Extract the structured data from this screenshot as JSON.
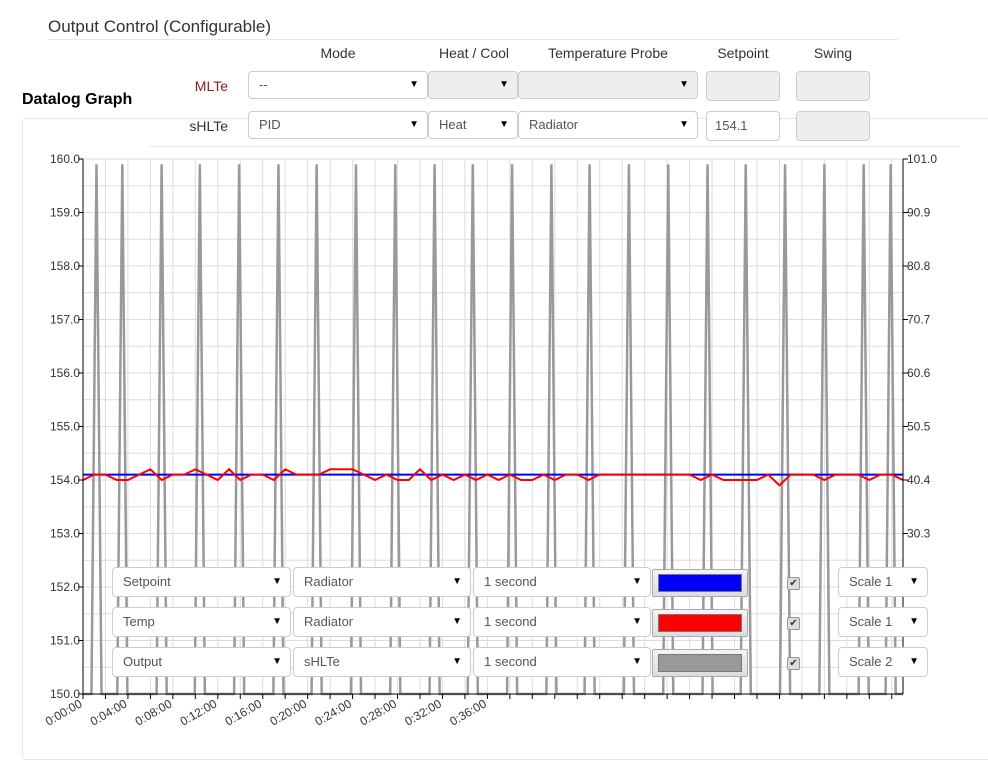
{
  "output_control": {
    "title": "Output Control (Configurable)",
    "headers": [
      "Mode",
      "Heat / Cool",
      "Temperature Probe",
      "Setpoint",
      "Swing"
    ],
    "rows": [
      {
        "label": "MLTe",
        "mode": "--",
        "heat_cool": "",
        "probe": "",
        "setpoint": "",
        "swing": "",
        "disabled": true
      },
      {
        "label": "sHLTe",
        "mode": "PID",
        "heat_cool": "Heat",
        "probe": "Radiator",
        "setpoint": "154.1",
        "swing": "",
        "disabled": false
      }
    ]
  },
  "datalog": {
    "title": "Datalog Graph",
    "series_rows": [
      {
        "type": "Setpoint",
        "source": "Radiator",
        "interval": "1 second",
        "color": "#0000ff",
        "checked": true,
        "scale": "Scale 1"
      },
      {
        "type": "Temp",
        "source": "Radiator",
        "interval": "1 second",
        "color": "#ff0000",
        "checked": true,
        "scale": "Scale 1"
      },
      {
        "type": "Output",
        "source": "sHLTe",
        "interval": "1 second",
        "color": "#999999",
        "checked": true,
        "scale": "Scale 2"
      }
    ]
  },
  "chart_data": {
    "type": "line",
    "grid": true,
    "xlim_minutes": [
      0,
      73
    ],
    "x_tick_labels": [
      "0:00:00",
      "0:04:00",
      "0:08:00",
      "0:12:00",
      "0:16:00",
      "0:20:00",
      "0:24:00",
      "0:28:00",
      "0:32:00",
      "0:36:00"
    ],
    "y_left": {
      "lim": [
        150,
        160
      ],
      "tick_labels": [
        "150.0",
        "151.0",
        "152.0",
        "153.0",
        "154.0",
        "155.0",
        "156.0",
        "157.0",
        "158.0",
        "159.0",
        "160.0"
      ]
    },
    "y_right": {
      "lim": [
        0,
        101
      ],
      "tick_labels": [
        "30.3",
        "40.4",
        "50.5",
        "60.6",
        "70.7",
        "80.8",
        "90.9",
        "101.0"
      ]
    },
    "series": [
      {
        "color": "#0000ff",
        "axis": "left",
        "x": [
          0,
          73
        ],
        "y": [
          154.1,
          154.1
        ]
      },
      {
        "color": "#ff0000",
        "axis": "left",
        "x": [
          0,
          1,
          2,
          3,
          4,
          5,
          6,
          7,
          8,
          9,
          10,
          11,
          12,
          13,
          14,
          15,
          16,
          17,
          18,
          19,
          20,
          21,
          22,
          23,
          24,
          25,
          26,
          27,
          28,
          29,
          30,
          31,
          32,
          33,
          34,
          35,
          36,
          37,
          38,
          39,
          40,
          41,
          42,
          43,
          44,
          45,
          46,
          47,
          48,
          49,
          50,
          51,
          52,
          53,
          54,
          55,
          56,
          57,
          58,
          59,
          60,
          61,
          62,
          63,
          64,
          65,
          66,
          67,
          68,
          69,
          70,
          71,
          72,
          73
        ],
        "y": [
          154.0,
          154.1,
          154.1,
          154.0,
          154.0,
          154.1,
          154.2,
          154.0,
          154.1,
          154.1,
          154.2,
          154.1,
          154.0,
          154.2,
          154.0,
          154.1,
          154.1,
          154.0,
          154.2,
          154.1,
          154.1,
          154.1,
          154.2,
          154.2,
          154.2,
          154.1,
          154.0,
          154.1,
          154.0,
          154.0,
          154.2,
          154.0,
          154.1,
          154.0,
          154.1,
          154.0,
          154.1,
          154.0,
          154.1,
          154.0,
          154.0,
          154.1,
          154.0,
          154.1,
          154.1,
          154.0,
          154.1,
          154.1,
          154.1,
          154.1,
          154.1,
          154.1,
          154.1,
          154.1,
          154.1,
          154.0,
          154.1,
          154.0,
          154.0,
          154.0,
          154.0,
          154.1,
          153.9,
          154.1,
          154.1,
          154.1,
          154.0,
          154.1,
          154.1,
          154.1,
          154.0,
          154.1,
          154.1,
          154.0
        ]
      },
      {
        "color": "#999999",
        "axis": "right",
        "spikes_at_minutes": [
          1.2,
          3.5,
          7.0,
          10.4,
          13.9,
          17.4,
          20.8,
          24.3,
          27.8,
          31.3,
          34.7,
          38.2,
          41.7,
          45.1,
          48.6,
          52.1,
          55.6,
          59.0,
          62.5,
          66.0,
          69.5,
          71.9
        ],
        "high": 100,
        "low": 0
      }
    ]
  }
}
